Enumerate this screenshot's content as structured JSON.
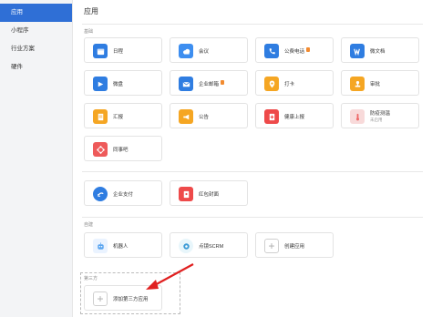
{
  "sidebar": {
    "items": [
      {
        "label": "应用",
        "active": true
      },
      {
        "label": "小程序",
        "active": false
      },
      {
        "label": "行业方案",
        "active": false
      },
      {
        "label": "硬件",
        "active": false
      }
    ]
  },
  "main": {
    "title": "应用",
    "sections": {
      "basic_label": "基础",
      "custom_label": "自建",
      "third_label": "第三方"
    },
    "apps": {
      "schedule": "日程",
      "meeting": "会议",
      "phone": "公费电话",
      "phone_badge": "",
      "wedoc": "微文档",
      "drive": "微盘",
      "mail": "企业邮箱",
      "mail_badge": "",
      "checkin": "打卡",
      "approval": "审批",
      "report": "汇报",
      "notice": "公告",
      "health": "健康上报",
      "epidemic": "防疫测温",
      "epidemic_sub": "未启用",
      "keyi": "同事吧",
      "pay": "企业支付",
      "redpacket": "红包封面"
    },
    "custom": {
      "robot": "机器人",
      "scrm": "点镜SCRM",
      "create": "创建应用"
    },
    "third": {
      "add": "添加第三方应用"
    }
  },
  "colors": {
    "accent": "#2f6fd6",
    "badge": "#f28b30",
    "arrow": "#e02020"
  }
}
